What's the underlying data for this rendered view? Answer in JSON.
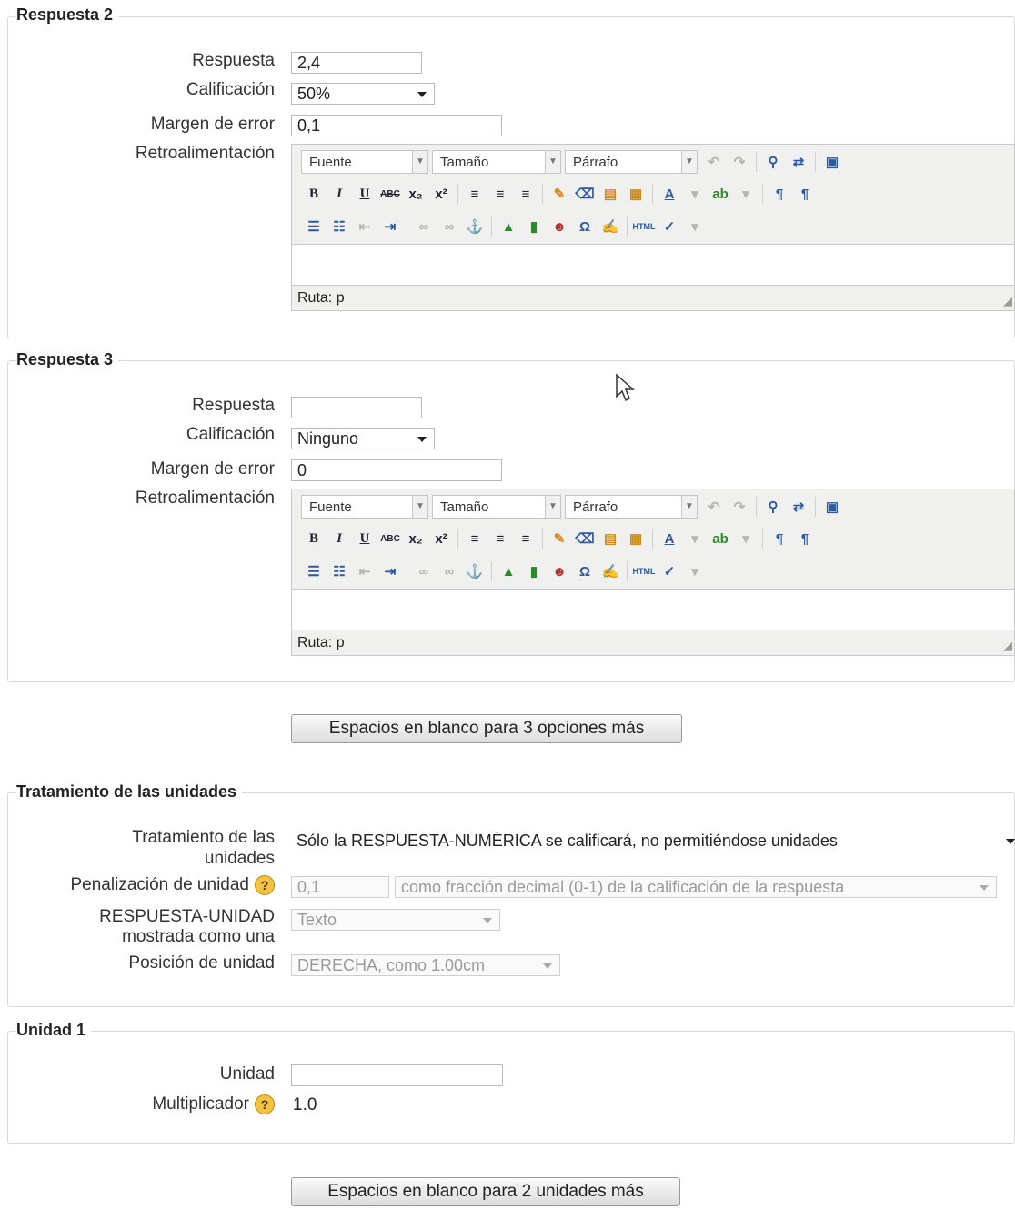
{
  "answer2": {
    "legend": "Respuesta 2",
    "labels": {
      "answer": "Respuesta",
      "grade": "Calificación",
      "tolerance": "Margen de error",
      "feedback": "Retroalimentación"
    },
    "answer_value": "2,4",
    "grade_value": "50%",
    "tolerance_value": "0,1"
  },
  "answer3": {
    "legend": "Respuesta 3",
    "labels": {
      "answer": "Respuesta",
      "grade": "Calificación",
      "tolerance": "Margen de error",
      "feedback": "Retroalimentación"
    },
    "answer_value": "",
    "grade_value": "Ninguno",
    "tolerance_value": "0"
  },
  "editor": {
    "font_label": "Fuente",
    "size_label": "Tamaño",
    "paragraph_label": "Párrafo",
    "path_text": "Ruta: p"
  },
  "more_answers_button": "Espacios en blanco para  3 opciones más",
  "units_handling": {
    "legend": "Tratamiento de las unidades",
    "label_handling_1": "Tratamiento de las",
    "label_handling_2": "unidades",
    "handling_value": "Sólo la RESPUESTA-NUMÉRICA se calificará, no permitiéndose unidades",
    "label_penalty": "Penalización de unidad",
    "penalty_value": "0,1",
    "penalty_mode": "como fracción decimal (0-1) de la calificación de la respuesta",
    "label_display_1": "RESPUESTA-UNIDAD",
    "label_display_2": "mostrada como una",
    "display_value": "Texto",
    "label_position": "Posición de unidad",
    "position_value": "DERECHA, como 1.00cm"
  },
  "unit1": {
    "legend": "Unidad 1",
    "label_unit": "Unidad",
    "unit_value": "",
    "label_multiplier": "Multiplicador",
    "multiplier_value": "1.0"
  },
  "more_units_button": "Espacios en blanco para 2 unidades más",
  "icons": {
    "help": "help-icon",
    "cursor": "mouse-pointer-icon"
  }
}
